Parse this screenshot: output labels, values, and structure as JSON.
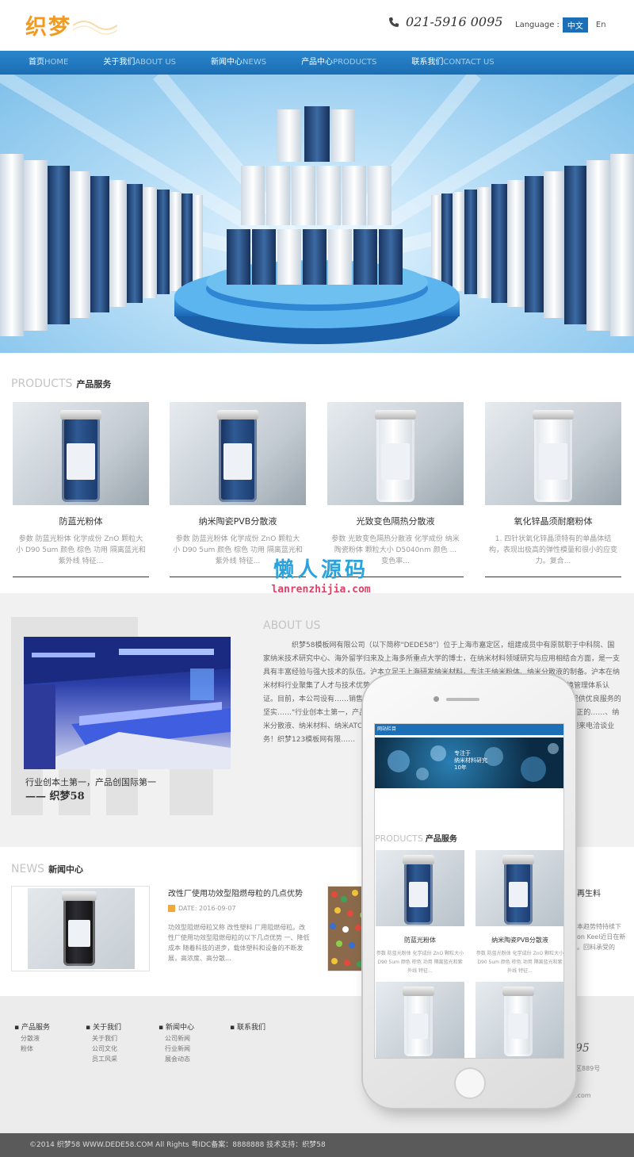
{
  "header": {
    "logo_text": "织梦",
    "phone": "021-5916 0095",
    "language_label": "Language :",
    "lang_cn": "中文",
    "lang_en": "En"
  },
  "nav": [
    {
      "cn": "首页",
      "en": "HOME"
    },
    {
      "cn": "关于我们",
      "en": "ABOUT US"
    },
    {
      "cn": "新闻中心",
      "en": "NEWS"
    },
    {
      "cn": "产品中心",
      "en": "PRODUCTS"
    },
    {
      "cn": "联系我们",
      "en": "CONTACT US"
    }
  ],
  "products_section": {
    "title_en": "PRODUCTS",
    "title_cn": "产品服务"
  },
  "products": [
    {
      "name": "防蓝光粉体",
      "desc": "参数 防蓝光粉体 化学成份 ZnO 颗粒大小 D90 5um 颜色 棕色 功用 隔离蓝光和紫外线 特征..."
    },
    {
      "name": "纳米陶瓷PVB分散液",
      "desc": "参数 防蓝光粉体 化学成份 ZnO 颗粒大小 D90 5um 颜色 棕色 功用 隔离蓝光和紫外线 特征..."
    },
    {
      "name": "光致变色隔热分散液",
      "desc": "参数 光致变色隔热分散液 化学成份 纳米陶瓷粉体 颗粒大小 D5040nm 颜色 ... 变色率..."
    },
    {
      "name": "氧化锌晶须耐磨粉体",
      "desc": "1. 四针状氧化锌晶须特有的单晶体结构，表现出极高的弹性模量和很小的应变力。复合..."
    }
  ],
  "watermark": {
    "big": "懒人源码",
    "small": "lanrenzhijia.com"
  },
  "about": {
    "title_en": "ABOUT US",
    "caption_line1": "行业创本土第一，产品创国际第一",
    "caption_line2": "—— 织梦58",
    "text": "织梦58模板网有限公司（以下简称\"DEDE58\"）位于上海市嘉定区，组建成员中有原就职于中科院、国家纳米技术研究中心、海外留学归来及上海多所重点大学的博士，在纳米材料领域研究与应用相结合方面，是一支具有丰富经验与强大技术的队伍。沪本立足于上海研发纳米材料，专注于纳米粉体、纳米分散液的制备。沪本在纳米材料行业聚集了人才与技术优势……3粉体及分散液被授予\"工程建设推荐产品\"……通过中国环境管理体系认证。目前，本公司设有……销售部，拥有员工60余名，真正实现了纳米行……研发团队，是\"沪本\"提供优良服务的坚实……\"行业创本土第一，产品创国际第一\"的经营理……新的理念、新的技术、新的服务，才能真正的……、纳米分散液、纳米材料、纳米ATO、纳米WO……，公司秉承\"保证一流质量，保持一级信……务。欢迎来电洽谈业务！织梦123模板网有限……"
  },
  "news_section": {
    "title_en": "NEWS",
    "title_cn": "新闻中心"
  },
  "news": [
    {
      "title": "改性厂使用功效型阻燃母粒的几点优势",
      "date_label": "DATE: 2016-09-07",
      "desc": "功效型阻燃母粒又称 改性塑料 厂用阻燃母粒。改性厂使用功效型阻燃母粒的以下几点优势 一、降低成本 随着科技的进步，载体塑料和设备的不断发展，高浓度、高分散..."
    }
  ],
  "news_peek": {
    "title_tail": "再生料",
    "line1": "本趋势特持续下",
    "line2": "on Keel近日在新",
    "line3": "。回料承受的"
  },
  "footer": {
    "cols": [
      {
        "title": "产品服务",
        "items": [
          "分散液",
          "粉体"
        ]
      },
      {
        "title": "关于我们",
        "items": [
          "关于我们",
          "公司文化",
          "员工风采"
        ]
      },
      {
        "title": "新闻中心",
        "items": [
          "公司新闻",
          "行业新闻",
          "展会动态"
        ]
      },
      {
        "title": "联系我们",
        "items": []
      }
    ],
    "peek_phone": "95",
    "peek_address": "区889号",
    "peek_email": ".com",
    "copyright": "©2014 织梦58 WWW.DEDE58.COM All Rights 粤IDC备案：8888888 技术支持：织梦58"
  },
  "phone_mock": {
    "bar_label": "网站栏目",
    "banner_text1": "专注于",
    "banner_text2": "纳米材料研究",
    "banner_text3": "10年",
    "title_en": "PRODUCTS",
    "title_cn": "产品服务",
    "products": [
      {
        "name": "防蓝光粉体",
        "desc": "参数 防蓝光粉体 化学成份 ZnO 颗粒大小 D90 5um 颜色 棕色 功用 隔离蓝光和紫外线 特征..."
      },
      {
        "name": "纳米陶瓷PVB分散液",
        "desc": "参数 防蓝光粉体 化学成份 ZnO 颗粒大小 D90 5um 颜色 棕色 功用 隔离蓝光和紫外线 特征..."
      }
    ]
  },
  "colors": {
    "brand_blue": "#1c6fb6",
    "logo_orange": "#f39a1c",
    "watermark_blue": "#2aa3dc",
    "watermark_red": "#e03f66"
  },
  "icons": [
    "phone-icon",
    "date-icon"
  ]
}
